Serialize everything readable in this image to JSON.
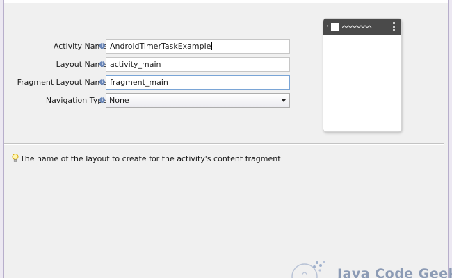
{
  "form": {
    "activity_name": {
      "label": "Activity Name",
      "value": "AndroidTimerTaskExample"
    },
    "layout_name": {
      "label": "Layout Name",
      "value": "activity_main"
    },
    "fragment_layout_name": {
      "label": "Fragment Layout Name",
      "value": "fragment_main"
    },
    "navigation_type": {
      "label": "Navigation Type",
      "selected": "None"
    }
  },
  "hint": {
    "text": "The name of the layout to create for the activity's content fragment"
  },
  "watermark": {
    "text": "Java Code Geeks"
  },
  "icons": {
    "info": "info-icon",
    "hint": "lightbulb-icon",
    "dropdown": "chevron-down-icon",
    "back": "back-icon",
    "overflow": "overflow-menu-icon"
  },
  "colors": {
    "focus_border": "#7aa5d6",
    "phone_bar": "#4a4a4a",
    "window_edge": "#b7aecb"
  }
}
